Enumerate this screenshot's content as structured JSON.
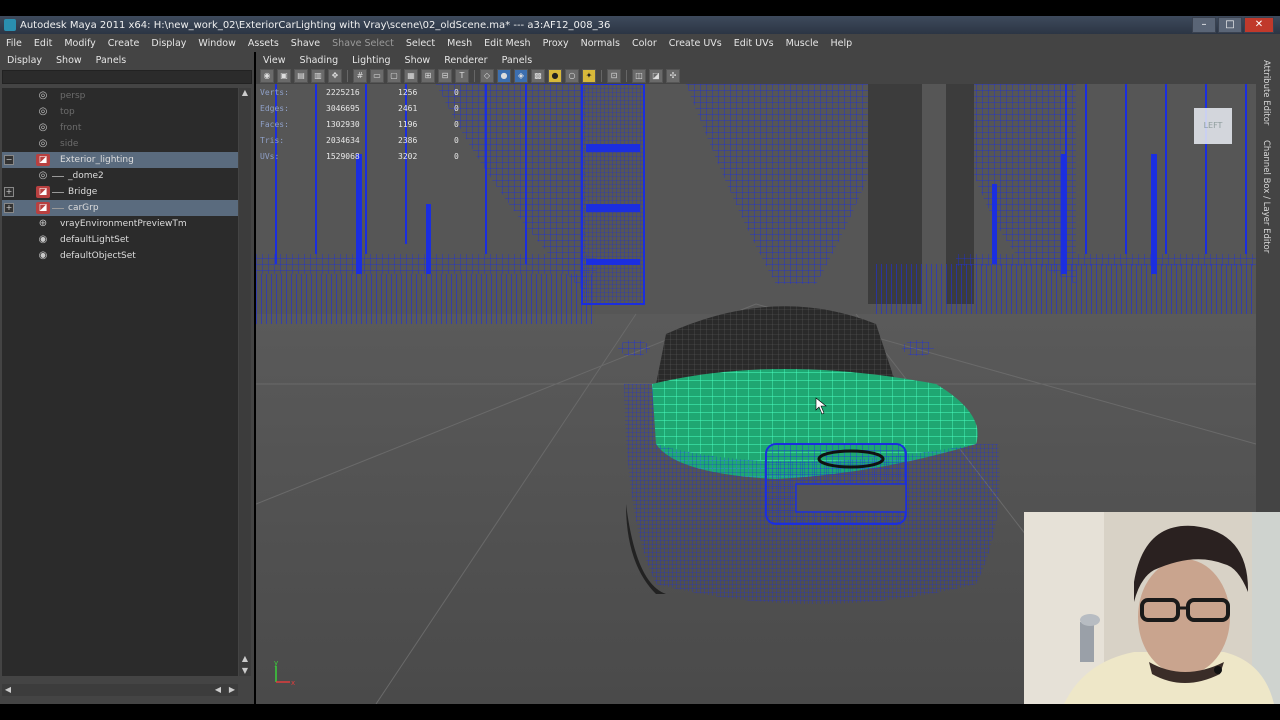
{
  "window": {
    "title": "Autodesk Maya 2011 x64: H:\\new_work_02\\ExteriorCarLighting with Vray\\scene\\02_oldScene.ma*   ---   a3:AF12_008_36",
    "controls": {
      "minimize": "–",
      "maximize": "□",
      "close": "✕"
    }
  },
  "menubar": {
    "items": [
      "File",
      "Edit",
      "Modify",
      "Create",
      "Display",
      "Window",
      "Assets",
      "Shave",
      "Shave Select",
      "Select",
      "Mesh",
      "Edit Mesh",
      "Proxy",
      "Normals",
      "Color",
      "Create UVs",
      "Edit UVs",
      "Muscle",
      "Help"
    ]
  },
  "outliner": {
    "menu": [
      "Display",
      "Show",
      "Panels"
    ],
    "items": [
      {
        "label": "persp",
        "icon": "camera-icon",
        "indent": 0,
        "dim": true,
        "expand": ""
      },
      {
        "label": "top",
        "icon": "camera-icon",
        "indent": 0,
        "dim": true,
        "expand": ""
      },
      {
        "label": "front",
        "icon": "camera-icon",
        "indent": 0,
        "dim": true,
        "expand": ""
      },
      {
        "label": "side",
        "icon": "camera-icon",
        "indent": 0,
        "dim": true,
        "expand": ""
      },
      {
        "label": "Exterior_lighting",
        "icon": "layer-icon",
        "indent": 0,
        "dim": false,
        "expand": "−",
        "selected": true
      },
      {
        "label": "_dome2",
        "icon": "camera-icon",
        "indent": 1,
        "dim": false,
        "expand": ""
      },
      {
        "label": "Bridge",
        "icon": "layer-icon",
        "indent": 1,
        "dim": false,
        "expand": "+"
      },
      {
        "label": "carGrp",
        "icon": "layer-icon",
        "indent": 1,
        "dim": false,
        "expand": "+",
        "selected": true
      },
      {
        "label": "vrayEnvironmentPreviewTm",
        "icon": "render-set-icon",
        "indent": 0,
        "dim": false,
        "expand": ""
      },
      {
        "label": "defaultLightSet",
        "icon": "set-icon",
        "indent": 0,
        "dim": false,
        "expand": ""
      },
      {
        "label": "defaultObjectSet",
        "icon": "set-icon",
        "indent": 0,
        "dim": false,
        "expand": ""
      }
    ]
  },
  "viewport": {
    "menu": [
      "View",
      "Shading",
      "Lighting",
      "Show",
      "Renderer",
      "Panels"
    ],
    "hud": [
      {
        "key": "Verts:",
        "v1": "2225216",
        "v2": "1256",
        "v3": "0"
      },
      {
        "key": "Edges:",
        "v1": "3046695",
        "v2": "2461",
        "v3": "0"
      },
      {
        "key": "Faces:",
        "v1": "1302930",
        "v2": "1196",
        "v3": "0"
      },
      {
        "key": "Tris:",
        "v1": "2034634",
        "v2": "2386",
        "v3": "0"
      },
      {
        "key": "UVs:",
        "v1": "1529068",
        "v2": "3202",
        "v3": "0"
      }
    ],
    "camera_label": "LEFT",
    "axis": {
      "y": "y",
      "x": "x"
    }
  },
  "right_tabs": [
    "Attribute Editor",
    "Channel Box / Layer Editor"
  ],
  "colors": {
    "wireframe_blue": "#1b2ee0",
    "selected_green": "#2ee8a0",
    "panel_bg": "#444444",
    "outliner_bg": "#2b2b2b",
    "selection_row": "#5a6b7e"
  }
}
